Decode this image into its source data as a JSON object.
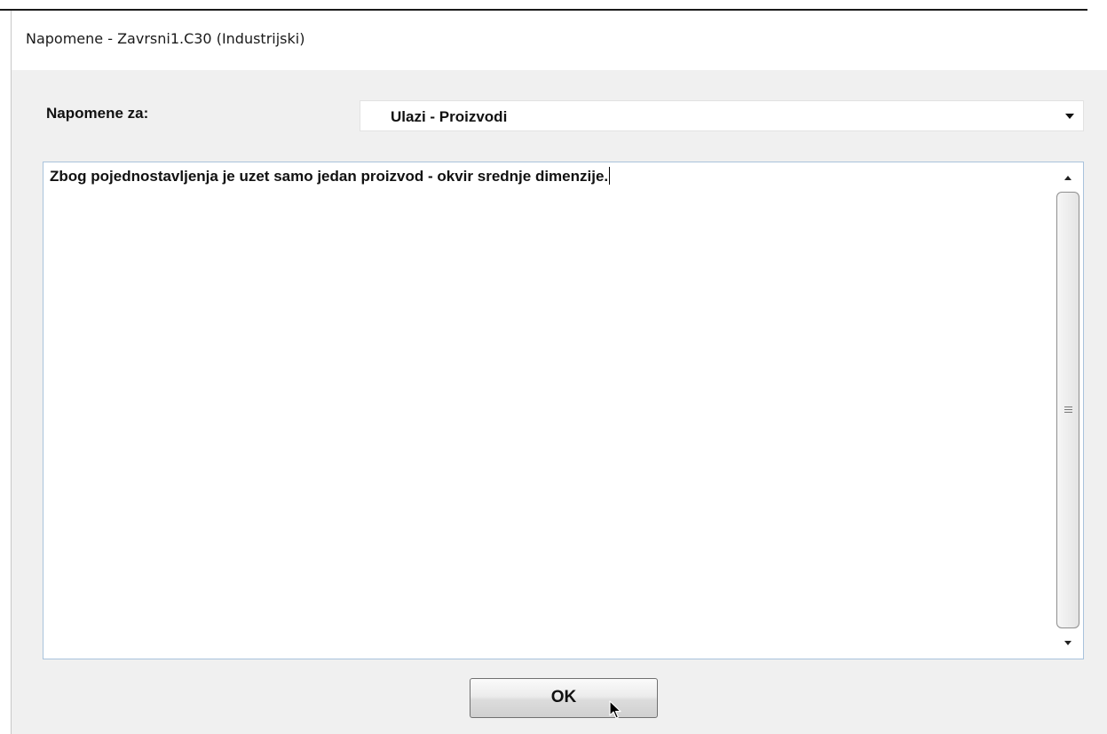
{
  "window": {
    "title": "Napomene - Zavrsni1.C30 (Industrijski)"
  },
  "form": {
    "notes_for_label": "Napomene za:",
    "notes_for_selected": "Ulazi - Proizvodi",
    "notes_text": "Zbog pojednostavljenja je uzet samo jedan proizvod - okvir srednje dimenzije."
  },
  "buttons": {
    "ok_label": "OK"
  },
  "icons": {
    "dropdown": "chevron-down-icon",
    "scroll_up": "scroll-up-arrow-icon",
    "scroll_down": "scroll-down-arrow-icon",
    "thumb_grip": "grip-icon",
    "mouse_cursor": "mouse-pointer-icon"
  }
}
